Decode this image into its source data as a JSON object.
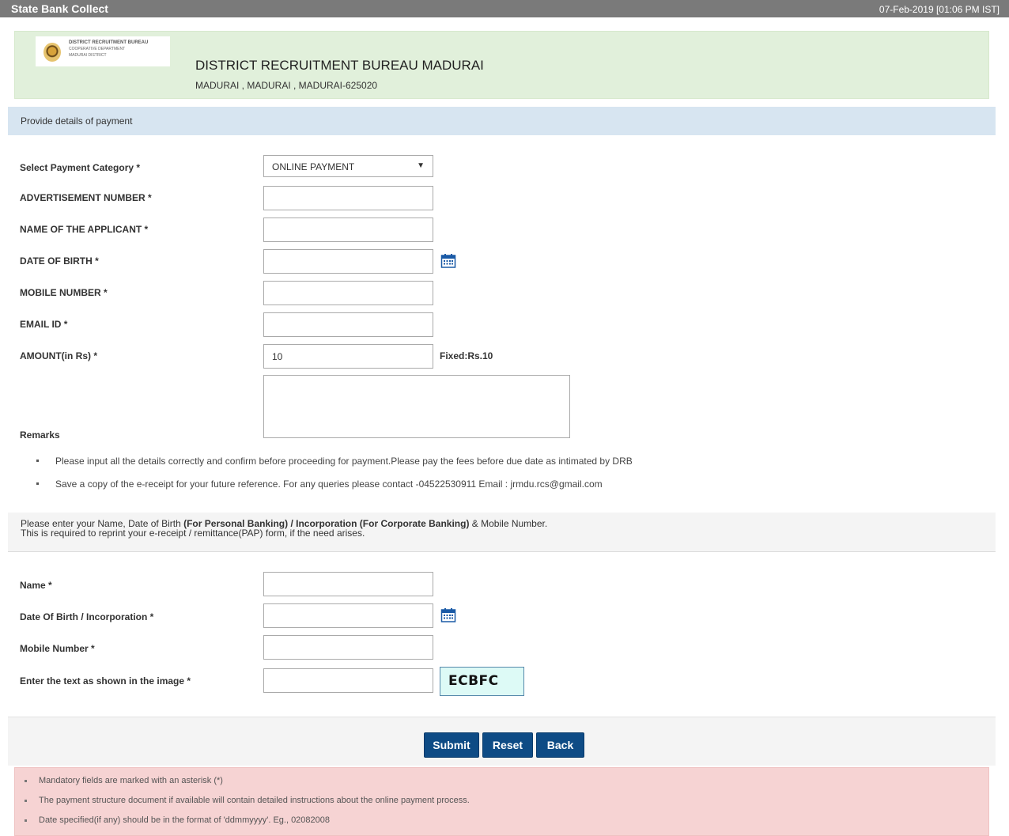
{
  "topbar": {
    "brand": "State Bank Collect",
    "datetime": "07-Feb-2019 [01:06 PM IST]"
  },
  "header": {
    "logo_lines": [
      "DISTRICT RECRUITMENT BUREAU",
      "COOPERATIVE DEPARTMENT",
      "MADURAI DISTRICT"
    ],
    "title": "DISTRICT RECRUITMENT BUREAU MADURAI",
    "address": "MADURAI , MADURAI , MADURAI-625020"
  },
  "section_title": "Provide details of payment",
  "payment_form": {
    "category_label": "Select Payment Category *",
    "category_value": "ONLINE PAYMENT",
    "advertisement_label": "ADVERTISEMENT NUMBER *",
    "applicant_label": "NAME OF THE APPLICANT *",
    "dob_label": "DATE OF BIRTH *",
    "mobile_label": "MOBILE NUMBER *",
    "email_label": "EMAIL ID *",
    "amount_label": "AMOUNT(in Rs) *",
    "amount_value": "10",
    "amount_note": "Fixed:Rs.10",
    "remarks_label": "Remarks"
  },
  "instructions": [
    "Please input all the details correctly and confirm before proceeding for payment.Please pay the fees before due date as intimated by DRB",
    "Save a copy of the e-receipt for your future reference. For any queries please contact -04522530911 Email : jrmdu.rcs@gmail.com"
  ],
  "reprint": {
    "text_1": "Please enter your Name, Date of Birth ",
    "bold_1": "(For Personal Banking) / Incorporation (For Corporate Banking)",
    "text_2": "  & Mobile Number.",
    "line_2": "This is required to reprint your e-receipt / remittance(PAP) form, if the need arises."
  },
  "reprint_form": {
    "name_label": "Name *",
    "dob_label": "Date Of Birth / Incorporation *",
    "mobile_label": "Mobile Number *",
    "captcha_label": "Enter the text as shown in the image *",
    "captcha_text": "ECBFC"
  },
  "buttons": {
    "submit": "Submit",
    "reset": "Reset",
    "back": "Back"
  },
  "notes": [
    "Mandatory fields are marked with an asterisk (*)",
    "The payment structure document if available will contain detailed instructions about the online payment process.",
    "Date specified(if any) should be in the format of 'ddmmyyyy'. Eg., 02082008"
  ],
  "colors": {
    "topbar": "#7a7a7a",
    "header_bg": "#e1f0db",
    "section_bg": "#d7e5f1",
    "button": "#0e4b85",
    "notes_bg": "#f6d3d3",
    "captcha_bg": "#ddfaf6"
  },
  "icons": {
    "calendar": "calendar-icon",
    "dropdown": "chevron-down-icon"
  }
}
